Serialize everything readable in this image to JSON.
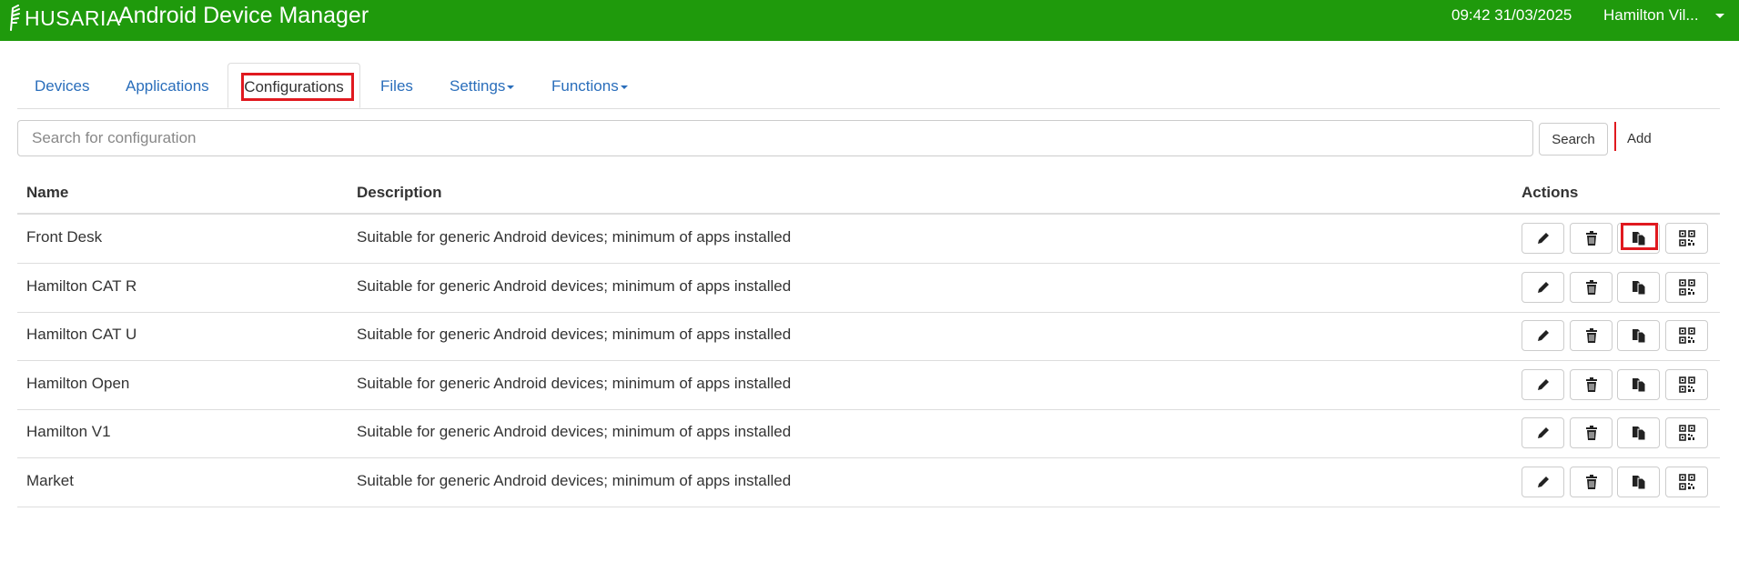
{
  "header": {
    "brand": "HUSARIA",
    "title": "Android Device Manager",
    "datetime": "09:42 31/03/2025",
    "user": "Hamilton Vil...",
    "color": "#1f9a0c"
  },
  "tabs": [
    {
      "label": "Devices",
      "active": false
    },
    {
      "label": "Applications",
      "active": false
    },
    {
      "label": "Configurations",
      "active": true
    },
    {
      "label": "Files",
      "active": false
    },
    {
      "label": "Settings",
      "active": false,
      "dropdown": true
    },
    {
      "label": "Functions",
      "active": false,
      "dropdown": true
    }
  ],
  "search": {
    "placeholder": "Search for configuration",
    "value": "",
    "button": "Search",
    "add": "Add"
  },
  "table": {
    "columns": [
      "Name",
      "Description",
      "Actions"
    ],
    "action_icons": [
      "pencil-icon",
      "trash-icon",
      "copy-icon",
      "qr-code-icon"
    ],
    "rows": [
      {
        "name": "Front Desk",
        "description": "Suitable for generic Android devices; minimum of apps installed"
      },
      {
        "name": "Hamilton CAT R",
        "description": "Suitable for generic Android devices; minimum of apps installed"
      },
      {
        "name": "Hamilton CAT U",
        "description": "Suitable for generic Android devices; minimum of apps installed"
      },
      {
        "name": "Hamilton Open",
        "description": "Suitable for generic Android devices; minimum of apps installed"
      },
      {
        "name": "Hamilton V1",
        "description": "Suitable for generic Android devices; minimum of apps installed"
      },
      {
        "name": "Market",
        "description": "Suitable for generic Android devices; minimum of apps installed"
      }
    ]
  },
  "highlight_color": "#e0191f"
}
